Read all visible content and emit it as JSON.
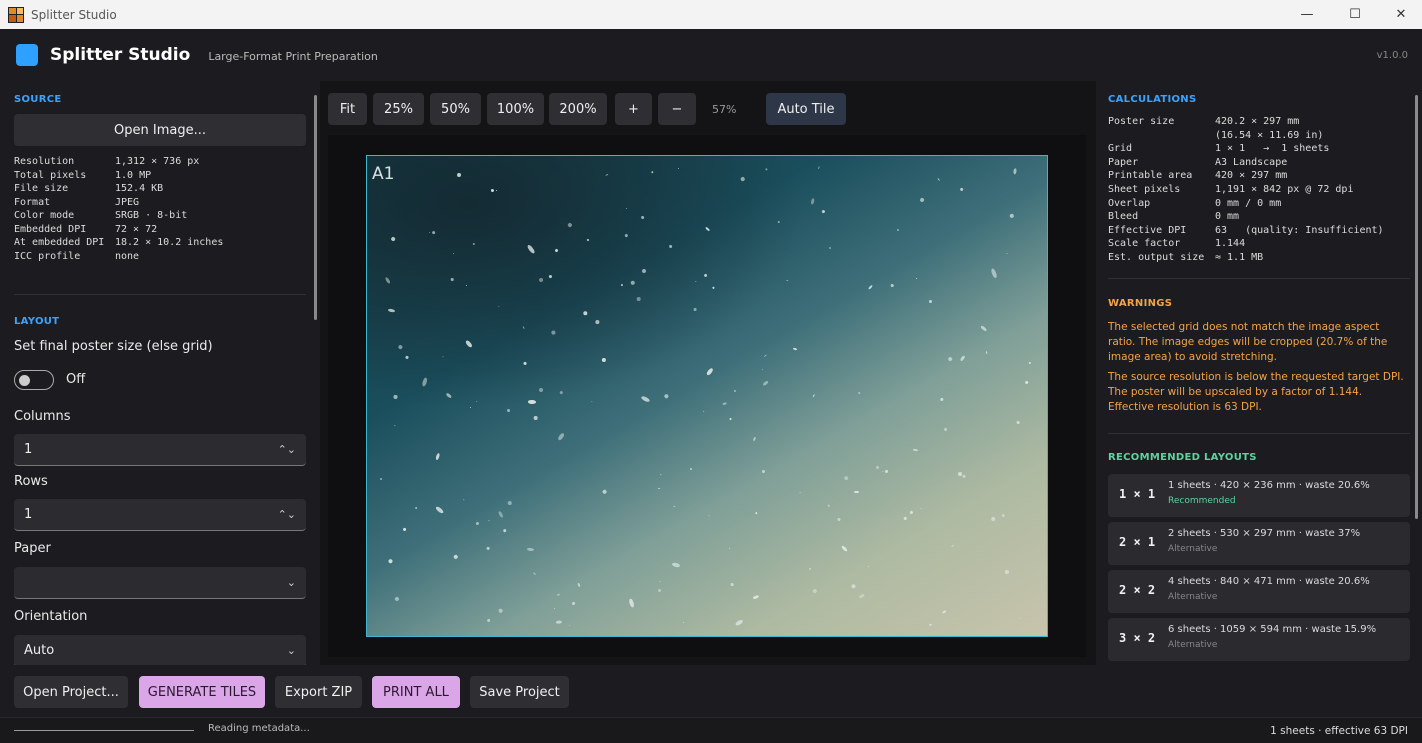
{
  "window": {
    "title": "Splitter Studio",
    "controls": [
      "—",
      "☐",
      "✕"
    ]
  },
  "header": {
    "app_name": "Splitter Studio",
    "subtitle": "Large-Format Print Preparation",
    "version": "v1.0.0"
  },
  "colors": {
    "accent_blue": "#3ba3ff",
    "warning_orange": "#f4a348",
    "success_green": "#5dd39e",
    "primary_button": "#dba6e8"
  },
  "source": {
    "title": "SOURCE",
    "open_button": "Open Image...",
    "info": [
      {
        "k": "Resolution",
        "v": "1,312 × 736 px"
      },
      {
        "k": "Total pixels",
        "v": "1.0 MP"
      },
      {
        "k": "File size",
        "v": "152.4 KB"
      },
      {
        "k": "Format",
        "v": "JPEG"
      },
      {
        "k": "Color mode",
        "v": "SRGB · 8-bit"
      },
      {
        "k": "Embedded DPI",
        "v": "72 × 72"
      },
      {
        "k": "At embedded DPI",
        "v": "18.2 × 10.2 inches"
      },
      {
        "k": "ICC profile",
        "v": "none"
      }
    ]
  },
  "layout": {
    "title": "LAYOUT",
    "poster_size_label": "Set final poster size (else grid)",
    "toggle_state": "Off",
    "columns_label": "Columns",
    "columns_value": "1",
    "rows_label": "Rows",
    "rows_value": "1",
    "paper_label": "Paper",
    "paper_value": "",
    "orientation_label": "Orientation",
    "orientation_value": "Auto"
  },
  "toolbar": {
    "fit": "Fit",
    "z25": "25%",
    "z50": "50%",
    "z100": "100%",
    "z200": "200%",
    "zoom_in": "+",
    "zoom_out": "−",
    "zoom_level": "57%",
    "auto_tile": "Auto Tile"
  },
  "preview": {
    "tile_label": "A1"
  },
  "calculations": {
    "title": "CALCULATIONS",
    "rows": [
      {
        "k": "Poster size",
        "v": "420.2 × 297 mm"
      },
      {
        "k": "",
        "v": "(16.54 × 11.69 in)"
      },
      {
        "k": "Grid",
        "v": "1 × 1   →  1 sheets"
      },
      {
        "k": "Paper",
        "v": "A3 Landscape"
      },
      {
        "k": "Printable area",
        "v": "420 × 297 mm"
      },
      {
        "k": "Sheet pixels",
        "v": "1,191 × 842 px @ 72 dpi"
      },
      {
        "k": "Overlap",
        "v": "0 mm / 0 mm"
      },
      {
        "k": "Bleed",
        "v": "0 mm"
      },
      {
        "k": "Effective DPI",
        "v": "63   (quality: Insufficient)"
      },
      {
        "k": "Scale factor",
        "v": "1.144"
      },
      {
        "k": "Est. output size",
        "v": "≈ 1.1 MB"
      }
    ]
  },
  "warnings": {
    "title": "WARNINGS",
    "items": [
      "The selected grid does not match the image aspect ratio. The image edges will be cropped (20.7% of the image area) to avoid stretching.",
      "The source resolution is below the requested target DPI. The poster will be upscaled by a factor of 1.144. Effective resolution is 63 DPI."
    ]
  },
  "recommended": {
    "title": "RECOMMENDED LAYOUTS",
    "items": [
      {
        "grid": "1 × 1",
        "desc": "1 sheets · 420 × 236 mm · waste 20.6%",
        "tag": "Recommended"
      },
      {
        "grid": "2 × 1",
        "desc": "2 sheets · 530 × 297 mm · waste 37%",
        "tag": "Alternative"
      },
      {
        "grid": "2 × 2",
        "desc": "4 sheets · 840 × 471 mm · waste 20.6%",
        "tag": "Alternative"
      },
      {
        "grid": "3 × 2",
        "desc": "6 sheets · 1059 × 594 mm · waste 15.9%",
        "tag": "Alternative"
      }
    ]
  },
  "footer": {
    "open_project": "Open Project...",
    "generate_tiles": "GENERATE TILES",
    "export_zip": "Export ZIP",
    "print_all": "PRINT ALL",
    "save_project": "Save Project"
  },
  "status": {
    "message": "Reading metadata...",
    "summary": "1 sheets · effective 63 DPI"
  }
}
